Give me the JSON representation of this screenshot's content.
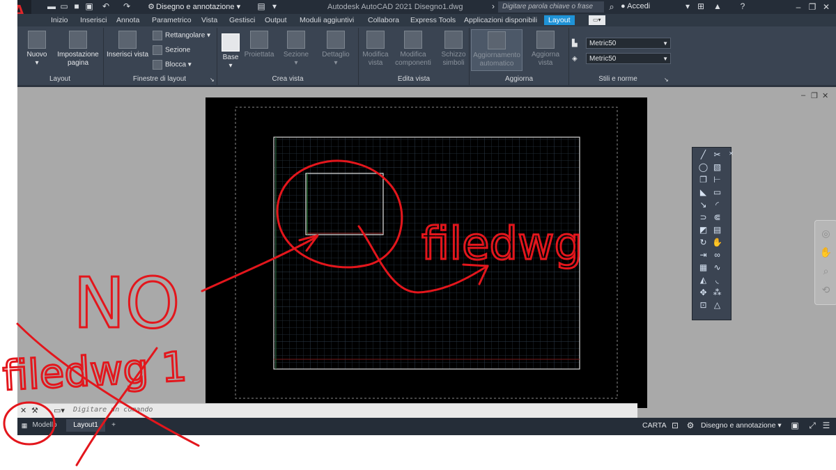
{
  "app": {
    "logo": "A",
    "title": "Autodesk AutoCAD 2021   Disegno1.dwg",
    "workspace": "Disegno e annotazione",
    "search_placeholder": "Digitare parola chiave o frase",
    "login": "Accedi",
    "quick_access_icons": [
      "new-file-icon",
      "open-folder-icon",
      "save-icon",
      "save-as-icon",
      "undo-icon",
      "redo-icon"
    ],
    "colors": {
      "accent": "#1f93d7",
      "title_bg": "#252d38",
      "ribbon_bg": "#3a4452",
      "canvas_bg": "#a9a9a9",
      "markup": "#e3161c"
    }
  },
  "tabs": [
    "Inizio",
    "Inserisci",
    "Annota",
    "Parametrico",
    "Vista",
    "Gestisci",
    "Output",
    "Moduli aggiuntivi",
    "Collabora",
    "Express Tools",
    "Applicazioni disponibili",
    "Layout"
  ],
  "active_tab": "Layout",
  "ribbon": {
    "panels": {
      "layout": "Layout",
      "finestre": "Finestre di layout",
      "crea_vista": "Crea vista",
      "edita_vista": "Edita vista",
      "aggiorna": "Aggiorna",
      "stili": "Stili e norme"
    },
    "buttons": {
      "nuovo": "Nuovo",
      "impostazione_1": "Impostazione",
      "impostazione_2": "pagina",
      "inserisci_vista": "Inserisci vista",
      "rettangolare": "Rettangolare",
      "sezione_small": "Sezione",
      "blocca": "Blocca",
      "base": "Base",
      "proiettata": "Proiettata",
      "sezione": "Sezione",
      "dettaglio": "Dettaglio",
      "modifica_vista_1": "Modifica",
      "modifica_vista_2": "vista",
      "modifica_comp_1": "Modifica",
      "modifica_comp_2": "componenti",
      "schizzo_1": "Schizzo",
      "schizzo_2": "simboli",
      "aggiornamento_1": "Aggiornamento",
      "aggiornamento_2": "automatico",
      "aggiorna_vista_1": "Aggiorna",
      "aggiorna_vista_2": "vista"
    },
    "styles": [
      "Metric50",
      "Metric50"
    ]
  },
  "command_line": {
    "placeholder": "Digitare un comando"
  },
  "layout_tabs": {
    "model": "Modello",
    "layout1": "Layout1",
    "add": "+"
  },
  "status": {
    "paper": "CARTA",
    "workspace": "Disegno e annotazione"
  },
  "annotations": {
    "left_text": "NO",
    "left_crossed": "filedwg 1",
    "right_text": "filedwg"
  }
}
